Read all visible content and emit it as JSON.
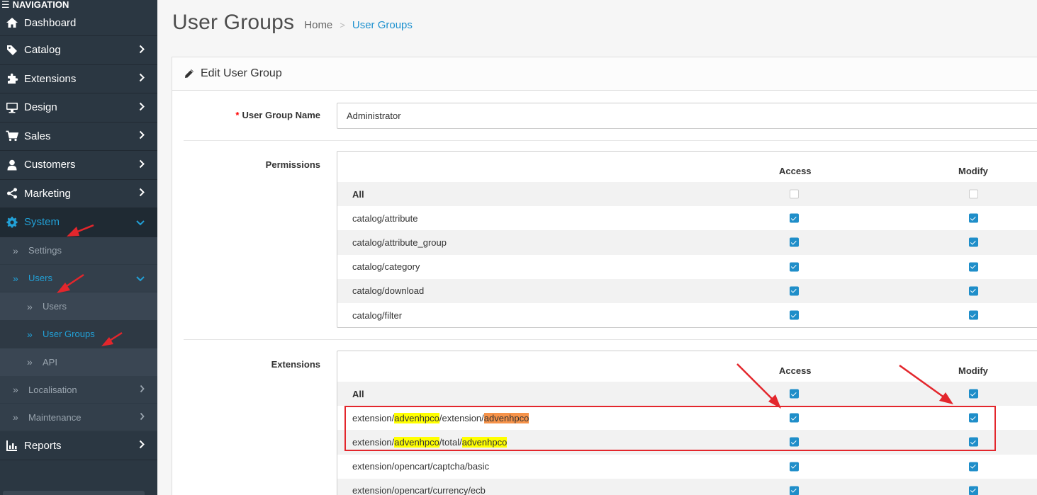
{
  "nav": {
    "header": "NAVIGATION",
    "items": [
      {
        "label": "Dashboard",
        "icon": "home-icon"
      },
      {
        "label": "Catalog",
        "icon": "tag-icon"
      },
      {
        "label": "Extensions",
        "icon": "puzzle-icon"
      },
      {
        "label": "Design",
        "icon": "desktop-icon"
      },
      {
        "label": "Sales",
        "icon": "cart-icon"
      },
      {
        "label": "Customers",
        "icon": "user-icon"
      },
      {
        "label": "Marketing",
        "icon": "share-icon"
      },
      {
        "label": "System",
        "icon": "gear-icon"
      }
    ],
    "system_sub": [
      {
        "label": "Settings"
      },
      {
        "label": "Users"
      }
    ],
    "users_sub": [
      {
        "label": "Users"
      },
      {
        "label": "User Groups"
      },
      {
        "label": "API"
      }
    ],
    "system_sub_after": [
      {
        "label": "Localisation"
      },
      {
        "label": "Maintenance"
      }
    ],
    "reports": {
      "label": "Reports",
      "icon": "chart-icon"
    }
  },
  "header": {
    "title": "User Groups",
    "breadcrumb_home": "Home",
    "breadcrumb_sep": ">",
    "breadcrumb_current": "User Groups"
  },
  "panel": {
    "heading": "Edit User Group",
    "name_label": "User Group Name",
    "name_required_mark": "*",
    "name_value": "Administrator",
    "permissions_label": "Permissions",
    "extensions_label": "Extensions",
    "col_access": "Access",
    "col_modify": "Modify"
  },
  "permissions": [
    {
      "label": "All",
      "access": false,
      "modify": false
    },
    {
      "label": "catalog/attribute",
      "access": true,
      "modify": true
    },
    {
      "label": "catalog/attribute_group",
      "access": true,
      "modify": true
    },
    {
      "label": "catalog/category",
      "access": true,
      "modify": true
    },
    {
      "label": "catalog/download",
      "access": true,
      "modify": true
    },
    {
      "label": "catalog/filter",
      "access": true,
      "modify": true
    }
  ],
  "extensions": [
    {
      "label": "All",
      "access": true,
      "modify": true
    },
    {
      "parts": [
        "extension/",
        "advenhpco",
        "/extension/",
        "advenhpco"
      ],
      "access": true,
      "modify": true
    },
    {
      "parts": [
        "extension/",
        "advenhpco",
        "/total/",
        "advenhpco"
      ],
      "access": true,
      "modify": true
    },
    {
      "label": "extension/opencart/captcha/basic",
      "access": true,
      "modify": true
    },
    {
      "label": "extension/opencart/currency/ecb",
      "access": true,
      "modify": true
    }
  ],
  "colors": {
    "sidebar_bg": "#2b3742",
    "accent": "#1e91cf",
    "annotation_red": "#e3262c",
    "highlight_yellow": "#ffff00",
    "highlight_orange": "#f6934a"
  }
}
